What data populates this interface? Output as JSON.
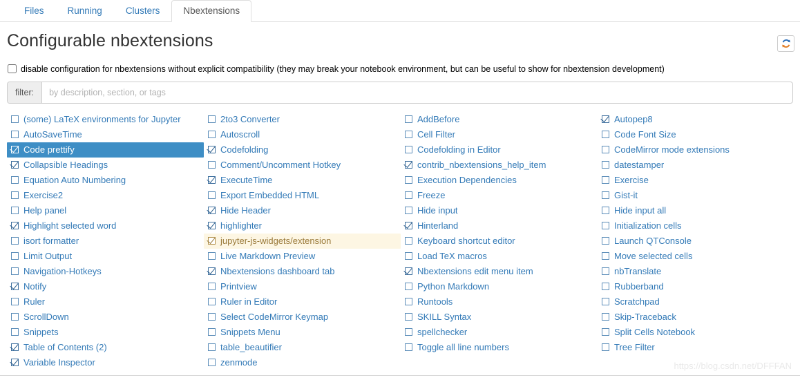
{
  "tabs": [
    {
      "label": "Files",
      "active": false
    },
    {
      "label": "Running",
      "active": false
    },
    {
      "label": "Clusters",
      "active": false
    },
    {
      "label": "Nbextensions",
      "active": true
    }
  ],
  "header": {
    "title": "Configurable nbextensions",
    "refresh_icon": "refresh-icon"
  },
  "disable_config": {
    "checked": false,
    "label": "disable configuration for nbextensions without explicit compatibility (they may break your notebook environment, but can be useful to show for nbextension development)"
  },
  "filter": {
    "addon_label": "filter:",
    "placeholder": "by description, section, or tags",
    "value": ""
  },
  "columns": [
    [
      {
        "label": "(some) LaTeX environments for Jupyter",
        "checked": false,
        "state": "normal"
      },
      {
        "label": "AutoSaveTime",
        "checked": false,
        "state": "normal"
      },
      {
        "label": "Code prettify",
        "checked": true,
        "state": "selected"
      },
      {
        "label": "Collapsible Headings",
        "checked": true,
        "state": "normal"
      },
      {
        "label": "Equation Auto Numbering",
        "checked": false,
        "state": "normal"
      },
      {
        "label": "Exercise2",
        "checked": false,
        "state": "normal"
      },
      {
        "label": "Help panel",
        "checked": false,
        "state": "normal"
      },
      {
        "label": "Highlight selected word",
        "checked": true,
        "state": "normal"
      },
      {
        "label": "isort formatter",
        "checked": false,
        "state": "normal"
      },
      {
        "label": "Limit Output",
        "checked": false,
        "state": "normal"
      },
      {
        "label": "Navigation-Hotkeys",
        "checked": false,
        "state": "normal"
      },
      {
        "label": "Notify",
        "checked": true,
        "state": "normal"
      },
      {
        "label": "Ruler",
        "checked": false,
        "state": "normal"
      },
      {
        "label": "ScrollDown",
        "checked": false,
        "state": "normal"
      },
      {
        "label": "Snippets",
        "checked": false,
        "state": "normal"
      },
      {
        "label": "Table of Contents (2)",
        "checked": true,
        "state": "normal"
      },
      {
        "label": "Variable Inspector",
        "checked": true,
        "state": "normal"
      }
    ],
    [
      {
        "label": "2to3 Converter",
        "checked": false,
        "state": "normal"
      },
      {
        "label": "Autoscroll",
        "checked": false,
        "state": "normal"
      },
      {
        "label": "Codefolding",
        "checked": true,
        "state": "normal"
      },
      {
        "label": "Comment/Uncomment Hotkey",
        "checked": false,
        "state": "normal"
      },
      {
        "label": "ExecuteTime",
        "checked": true,
        "state": "normal"
      },
      {
        "label": "Export Embedded HTML",
        "checked": false,
        "state": "normal"
      },
      {
        "label": "Hide Header",
        "checked": true,
        "state": "normal"
      },
      {
        "label": "highlighter",
        "checked": true,
        "state": "normal"
      },
      {
        "label": "jupyter-js-widgets/extension",
        "checked": true,
        "state": "warn"
      },
      {
        "label": "Live Markdown Preview",
        "checked": false,
        "state": "normal"
      },
      {
        "label": "Nbextensions dashboard tab",
        "checked": true,
        "state": "normal"
      },
      {
        "label": "Printview",
        "checked": false,
        "state": "normal"
      },
      {
        "label": "Ruler in Editor",
        "checked": false,
        "state": "normal"
      },
      {
        "label": "Select CodeMirror Keymap",
        "checked": false,
        "state": "normal"
      },
      {
        "label": "Snippets Menu",
        "checked": false,
        "state": "normal"
      },
      {
        "label": "table_beautifier",
        "checked": false,
        "state": "normal"
      },
      {
        "label": "zenmode",
        "checked": false,
        "state": "normal"
      }
    ],
    [
      {
        "label": "AddBefore",
        "checked": false,
        "state": "normal"
      },
      {
        "label": "Cell Filter",
        "checked": false,
        "state": "normal"
      },
      {
        "label": "Codefolding in Editor",
        "checked": false,
        "state": "normal"
      },
      {
        "label": "contrib_nbextensions_help_item",
        "checked": true,
        "state": "normal"
      },
      {
        "label": "Execution Dependencies",
        "checked": false,
        "state": "normal"
      },
      {
        "label": "Freeze",
        "checked": false,
        "state": "normal"
      },
      {
        "label": "Hide input",
        "checked": false,
        "state": "normal"
      },
      {
        "label": "Hinterland",
        "checked": true,
        "state": "normal"
      },
      {
        "label": "Keyboard shortcut editor",
        "checked": false,
        "state": "normal"
      },
      {
        "label": "Load TeX macros",
        "checked": false,
        "state": "normal"
      },
      {
        "label": "Nbextensions edit menu item",
        "checked": true,
        "state": "normal"
      },
      {
        "label": "Python Markdown",
        "checked": false,
        "state": "normal"
      },
      {
        "label": "Runtools",
        "checked": false,
        "state": "normal"
      },
      {
        "label": "SKILL Syntax",
        "checked": false,
        "state": "normal"
      },
      {
        "label": "spellchecker",
        "checked": false,
        "state": "normal"
      },
      {
        "label": "Toggle all line numbers",
        "checked": false,
        "state": "normal"
      }
    ],
    [
      {
        "label": "Autopep8",
        "checked": true,
        "state": "normal"
      },
      {
        "label": "Code Font Size",
        "checked": false,
        "state": "normal"
      },
      {
        "label": "CodeMirror mode extensions",
        "checked": false,
        "state": "normal"
      },
      {
        "label": "datestamper",
        "checked": false,
        "state": "normal"
      },
      {
        "label": "Exercise",
        "checked": false,
        "state": "normal"
      },
      {
        "label": "Gist-it",
        "checked": false,
        "state": "normal"
      },
      {
        "label": "Hide input all",
        "checked": false,
        "state": "normal"
      },
      {
        "label": "Initialization cells",
        "checked": false,
        "state": "normal"
      },
      {
        "label": "Launch QTConsole",
        "checked": false,
        "state": "normal"
      },
      {
        "label": "Move selected cells",
        "checked": false,
        "state": "normal"
      },
      {
        "label": "nbTranslate",
        "checked": false,
        "state": "normal"
      },
      {
        "label": "Rubberband",
        "checked": false,
        "state": "normal"
      },
      {
        "label": "Scratchpad",
        "checked": false,
        "state": "normal"
      },
      {
        "label": "Skip-Traceback",
        "checked": false,
        "state": "normal"
      },
      {
        "label": "Split Cells Notebook",
        "checked": false,
        "state": "normal"
      },
      {
        "label": "Tree Filter",
        "checked": false,
        "state": "normal"
      }
    ]
  ],
  "watermark": "https://blog.csdn.net/DFFFAN",
  "colors": {
    "link": "#337ab7",
    "selected_bg": "#3e8ec5",
    "warn_bg": "#fdf6e3",
    "warn_text": "#9a7a3a"
  }
}
